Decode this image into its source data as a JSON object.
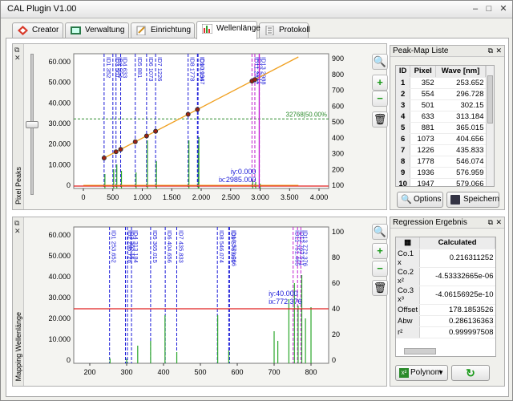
{
  "window": {
    "title": "CAL Plugin V1.00",
    "min": "–",
    "max": "□",
    "close": "✕"
  },
  "tabs": [
    {
      "label": "Creator",
      "active": false
    },
    {
      "label": "Verwaltung",
      "active": false
    },
    {
      "label": "Einrichtung",
      "active": false
    },
    {
      "label": "Wellenlänge",
      "active": true
    },
    {
      "label": "Protokoll",
      "active": false
    }
  ],
  "top_panel": {
    "side_label": "Pixel Peaks",
    "x_ticks": [
      "0",
      "500",
      "1.000",
      "1.500",
      "2.000",
      "2.500",
      "3.000",
      "3.500",
      "4.000"
    ],
    "y_left_ticks": [
      "0",
      "10.000",
      "20.000",
      "30.000",
      "40.000",
      "50.000",
      "60.000"
    ],
    "y_right_ticks": [
      "100",
      "200",
      "300",
      "400",
      "500",
      "600",
      "700",
      "800",
      "900"
    ],
    "threshold_label": "32768|50.00%",
    "cursor_iy": "iy:0.000",
    "cursor_ix": "ix:2985.000",
    "peak_labels": [
      "ID1 352",
      "ID2 554",
      "ID3 501",
      "ID4 633",
      "ID5 881",
      "ID6 1073",
      "ID7 1226",
      "ID8 1778",
      "ID9 1936",
      "ID10 1947",
      "ID11 2862",
      "ID12 2911",
      "ID13 2988"
    ]
  },
  "bottom_panel": {
    "side_label": "Mapping Wellenlänge",
    "x_ticks": [
      "200",
      "300",
      "400",
      "500",
      "600",
      "700",
      "800"
    ],
    "y_left_ticks": [
      "0",
      "10.000",
      "20.000",
      "30.000",
      "40.000",
      "50.000",
      "60.000"
    ],
    "y_right_ticks": [
      "0",
      "20",
      "40",
      "60",
      "80",
      "100"
    ],
    "cursor_iy": "iy:40.000",
    "cursor_ix": "ix:772.376",
    "peak_labels": [
      "ID1 253.652",
      "ID2 296.728",
      "ID3 302.15",
      "ID4 313.184",
      "ID5 365.015",
      "ID6 404.656",
      "ID7 435.833",
      "ID8 546.074",
      "ID9 576.959",
      "ID10 579.066",
      "ID11 751.465",
      "ID12 763.511",
      "ID13 772.376"
    ]
  },
  "peak_map": {
    "title": "Peak-Map Liste",
    "columns": [
      "ID",
      "Pixel",
      "Wave [nm]"
    ],
    "rows": [
      [
        "1",
        "352",
        "253.652"
      ],
      [
        "2",
        "554",
        "296.728"
      ],
      [
        "3",
        "501",
        "302.15"
      ],
      [
        "4",
        "633",
        "313.184"
      ],
      [
        "5",
        "881",
        "365.015"
      ],
      [
        "6",
        "1073",
        "404.656"
      ],
      [
        "7",
        "1226",
        "435.833"
      ],
      [
        "8",
        "1778",
        "546.074"
      ],
      [
        "9",
        "1936",
        "576.959"
      ],
      [
        "10",
        "1947",
        "579.066"
      ]
    ],
    "options_label": "Options",
    "save_label": "Speichern"
  },
  "regression": {
    "title": "Regression Ergebnis",
    "column": "Calculated",
    "rows": [
      [
        "Co.1 x",
        "0.216311252"
      ],
      [
        "Co.2 x²",
        "-4.53332665e-06"
      ],
      [
        "Co.3 x³",
        "-4.06156925e-10"
      ],
      [
        "Offset",
        "178.1853526"
      ],
      [
        "Abw",
        "0.286136363"
      ],
      [
        "r²",
        "0.999997508"
      ]
    ],
    "method": "Polynom"
  },
  "colors": {
    "accent_red": "#e02020",
    "peak_blue": "#1a1ad8",
    "peak_magenta": "#c020d0",
    "signal_green": "#2aa62a",
    "curve_orange": "#f0a020"
  }
}
